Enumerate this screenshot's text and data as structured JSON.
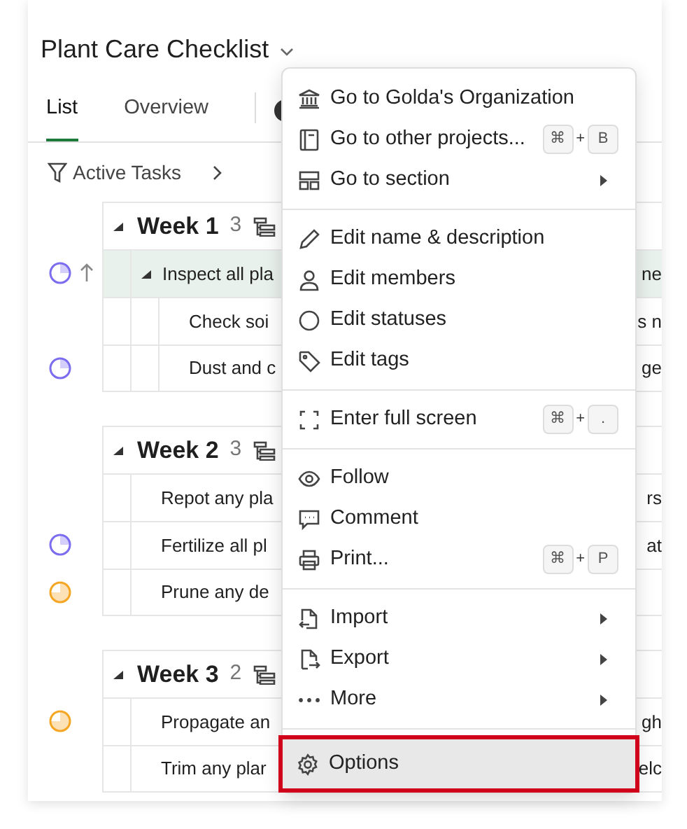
{
  "project": {
    "title": "Plant Care Checklist"
  },
  "tabs": [
    {
      "label": "List",
      "selected": true
    },
    {
      "label": "Overview",
      "selected": false
    }
  ],
  "filter": {
    "label": "Active Tasks"
  },
  "sections": [
    {
      "title": "Week 1",
      "count": "3",
      "expanded": true,
      "tasks": [
        {
          "text": "Inspect all pla",
          "right": "ne",
          "highlighted": true,
          "expanded": true,
          "status": {
            "color": "#7b6cf0",
            "kind": "quarter"
          },
          "priority_up": true,
          "children": [
            {
              "text": "Check soi",
              "right": "s n",
              "highlighted": false,
              "priority_up": false
            },
            {
              "text": "Dust and c",
              "right": "ge",
              "highlighted": false,
              "status": {
                "color": "#7b6cf0",
                "kind": "quarter"
              },
              "priority_up": false
            }
          ]
        }
      ]
    },
    {
      "title": "Week 2",
      "count": "3",
      "expanded": true,
      "tasks": [
        {
          "text": "Repot any pla",
          "right": "rs",
          "highlighted": false,
          "priority_up": false
        },
        {
          "text": "Fertilize all pl",
          "right": "at",
          "highlighted": false,
          "status": {
            "color": "#7b6cf0",
            "kind": "quarter"
          },
          "priority_up": false
        },
        {
          "text": "Prune any de",
          "highlighted": false,
          "status": {
            "color": "#f5a623",
            "kind": "three_quarters"
          },
          "priority_up": false
        }
      ]
    },
    {
      "title": "Week 3",
      "count": "2",
      "expanded": true,
      "tasks": [
        {
          "text": "Propagate an",
          "right": "gh",
          "highlighted": false,
          "status": {
            "color": "#f5a623",
            "kind": "three_quarters"
          },
          "priority_up": false
        },
        {
          "text": "Trim any plar",
          "right": "elc",
          "highlighted": false,
          "priority_up": false
        }
      ]
    }
  ],
  "menu": {
    "groups": [
      [
        {
          "label": "Go to Golda's Organization",
          "submenu": false
        },
        {
          "label": "Go to other projects...",
          "submenu": false,
          "shortcut": [
            {
              "kind": "key",
              "text": "⌘"
            },
            {
              "kind": "plus",
              "text": "+"
            },
            {
              "kind": "key",
              "text": "B"
            }
          ]
        },
        {
          "label": "Go to section",
          "submenu": true
        }
      ],
      [
        {
          "label": "Edit name & description",
          "submenu": false
        },
        {
          "label": "Edit members",
          "submenu": false
        },
        {
          "label": "Edit statuses",
          "submenu": false
        },
        {
          "label": "Edit tags",
          "submenu": false
        }
      ],
      [
        {
          "label": "Enter full screen",
          "submenu": false,
          "shortcut": [
            {
              "kind": "key",
              "text": "⌘"
            },
            {
              "kind": "plus",
              "text": "+"
            },
            {
              "kind": "key",
              "text": "."
            }
          ]
        }
      ],
      [
        {
          "label": "Follow",
          "submenu": false
        },
        {
          "label": "Comment",
          "submenu": false
        },
        {
          "label": "Print...",
          "submenu": false,
          "shortcut": [
            {
              "kind": "key",
              "text": "⌘"
            },
            {
              "kind": "plus",
              "text": "+"
            },
            {
              "kind": "key",
              "text": "P"
            }
          ]
        }
      ],
      [
        {
          "label": "Import",
          "submenu": true
        },
        {
          "label": "Export",
          "submenu": true
        },
        {
          "label": "More",
          "submenu": true
        }
      ],
      [
        {
          "label": "Options",
          "submenu": false,
          "selected": true,
          "annotated": true
        }
      ]
    ]
  }
}
